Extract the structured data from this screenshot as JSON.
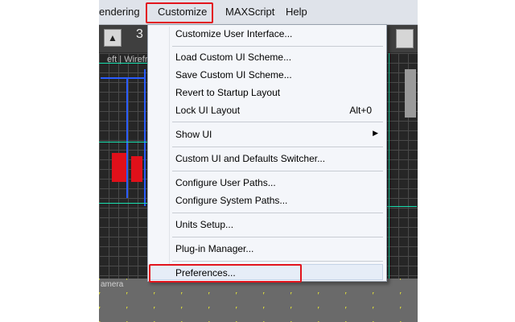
{
  "menubar": {
    "items": [
      "endering",
      "Customize",
      "MAXScript",
      "Help"
    ]
  },
  "toolbar": {
    "number": "3"
  },
  "viewport": {
    "top_label": "eft | Wirefr",
    "bottom_label": "amera"
  },
  "dropdown": {
    "items": [
      {
        "label": "Customize User Interface..."
      },
      {
        "label": "Load Custom UI Scheme..."
      },
      {
        "label": "Save Custom UI Scheme..."
      },
      {
        "label": "Revert to Startup Layout"
      },
      {
        "label": "Lock UI Layout",
        "shortcut": "Alt+0"
      },
      {
        "label": "Show UI",
        "arrow": "▶"
      },
      {
        "label": "Custom UI and Defaults Switcher..."
      },
      {
        "label": "Configure User Paths..."
      },
      {
        "label": "Configure System Paths..."
      },
      {
        "label": "Units Setup..."
      },
      {
        "label": "Plug-in Manager..."
      },
      {
        "label": "Preferences..."
      }
    ]
  },
  "colors": {
    "highlight": "#e2141c"
  }
}
